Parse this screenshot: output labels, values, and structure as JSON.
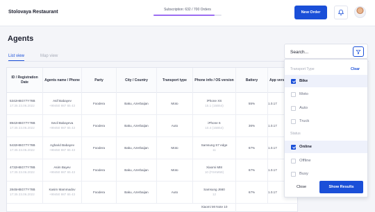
{
  "header": {
    "brand": "Stolovaya Restaurant",
    "subscription_text": "Subscription: 632 / 700 Orders",
    "subscription_progress": 0.903,
    "new_order_label": "New Order",
    "bell_icon": "bell-icon",
    "accent": "#1a4fd8",
    "progress_color": "#9b6cf2"
  },
  "page": {
    "title": "Agents"
  },
  "tabs": [
    {
      "label": "List view",
      "active": true
    },
    {
      "label": "Map view",
      "active": false
    }
  ],
  "table": {
    "columns": [
      "ID / Registration Date",
      "Agents name / Phone",
      "Party",
      "City / Country",
      "Transport type",
      "Phone info / OS version",
      "Battery",
      "App versi"
    ],
    "rows": [
      {
        "id": "5342HBG77Y78B",
        "date": "17:35 23.06.2022",
        "name": "Asif Babayev",
        "phone": "+99450 987 65 43",
        "party": "Foodera",
        "city": "Baku, Azerbaijan",
        "transport": "Moto",
        "device": "iPhone XS",
        "os": "15.1 (15B54)",
        "battery": "55%",
        "app": "1.0.17"
      },
      {
        "id": "8942HBG77Y78B",
        "date": "17:35 23.06.2022",
        "name": "Sevil Babayeva",
        "phone": "+99450 987 65 43",
        "party": "Foodera",
        "city": "Baku, Azerbaijan",
        "transport": "Auto",
        "device": "iPhone 6",
        "os": "10.4 (15B54)",
        "battery": "36%",
        "app": "1.0.17"
      },
      {
        "id": "5432HBG77Y78B",
        "date": "17:35 23.06.2022",
        "name": "Agharid Babayev",
        "phone": "+99450 987 65 43",
        "party": "Foodera",
        "city": "Baku, Azerbaijan",
        "transport": "Moto",
        "device": "Samsung S7 edge",
        "os": "11",
        "battery": "67%",
        "app": "1.0.17"
      },
      {
        "id": "4732HBG77Y78B",
        "date": "17:35 23.06.2022",
        "name": "Asim Bayev",
        "phone": "+99450 987 65 43",
        "party": "Foodera",
        "city": "Baku, Azerbaijan",
        "transport": "Moto",
        "device": "Xiaomi MI8",
        "os": "10 (FSKM59)",
        "battery": "67%",
        "app": "1.0.17"
      },
      {
        "id": "2845HBG77Y78B",
        "date": "17:35 23.06.2022",
        "name": "Kasim Mammadov",
        "phone": "+99450 987 65 43",
        "party": "Foodera",
        "city": "Baku, Azerbaijan",
        "transport": "Auto",
        "device": "Samsung J660",
        "os": "12",
        "battery": "67%",
        "app": "1.0.17"
      },
      {
        "id": "",
        "date": "",
        "name": "",
        "phone": "",
        "party": "",
        "city": "",
        "transport": "",
        "device": "Xiaomi MI Note 10",
        "os": "",
        "battery": "",
        "app": ""
      }
    ]
  },
  "filter": {
    "search_placeholder": "Search...",
    "filter_icon": "funnel-icon",
    "transport_heading": "Transport Type",
    "clear_label": "Clear",
    "transport_options": [
      {
        "label": "Bike",
        "checked": true
      },
      {
        "label": "Moto",
        "checked": false
      },
      {
        "label": "Auto",
        "checked": false
      },
      {
        "label": "Truck",
        "checked": false
      }
    ],
    "status_heading": "Status",
    "status_options": [
      {
        "label": "Online",
        "checked": true
      },
      {
        "label": "Offline",
        "checked": false
      },
      {
        "label": "Busy",
        "checked": false
      }
    ],
    "close_label": "Close",
    "show_label": "Show Results"
  }
}
